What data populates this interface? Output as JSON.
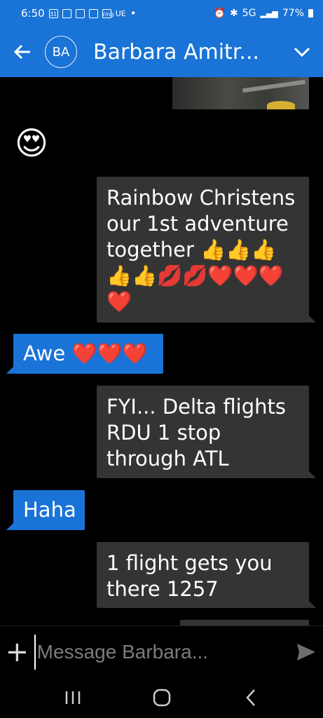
{
  "status_bar": {
    "time": "6:50",
    "left_icons": [
      "calendar-icon",
      "news-icon",
      "news2-icon",
      "gallery-icon",
      "ring-icon"
    ],
    "calendar_day": "31",
    "ring_label": "ring",
    "ue_label": "UE",
    "network": "5G",
    "battery": "77%"
  },
  "header": {
    "avatar_initials": "BA",
    "title": "Barbara Amitr...",
    "color": "#1a73d6"
  },
  "messages": [
    {
      "type": "received_emoji",
      "text": "😍"
    },
    {
      "type": "sent",
      "text": "Rainbow Christens our 1st adventure together 👍👍👍👍👍💋💋❤️❤️❤️❤️"
    },
    {
      "type": "received",
      "text": "Awe ❤️❤️❤️"
    },
    {
      "type": "sent",
      "text": "FYI... Delta flights RDU 1 stop through ATL"
    },
    {
      "type": "received",
      "text": "Haha"
    },
    {
      "type": "sent",
      "text": "1 flight gets you there 1257"
    }
  ],
  "composer": {
    "placeholder": "Message Barbara..."
  }
}
